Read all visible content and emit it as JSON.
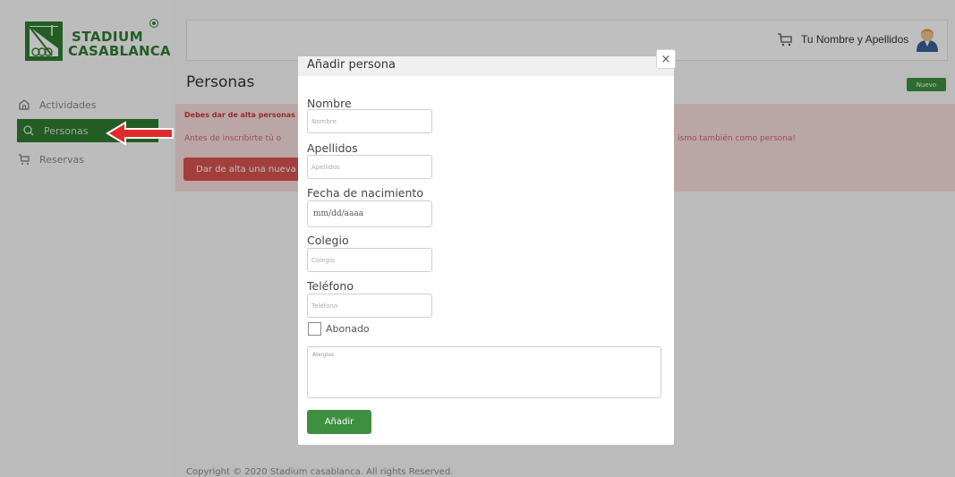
{
  "brand": {
    "line1": "STADIUM",
    "line2": "CASABLANCA",
    "accent": "#2f7d31"
  },
  "sidebar": {
    "items": [
      {
        "label": "Actividades",
        "icon": "home-icon"
      },
      {
        "label": "Personas",
        "icon": "search-icon",
        "active": true
      },
      {
        "label": "Reservas",
        "icon": "cart-icon"
      }
    ]
  },
  "header": {
    "user_name": "Tu Nombre y Apellidos"
  },
  "page": {
    "title": "Personas",
    "new_button": "Nuevo",
    "alert": {
      "title": "Debes dar de alta personas",
      "text_left": "Antes de inscribirte tú o",
      "text_right": "ismo también como persona!",
      "button": "Dar de alta una nueva"
    },
    "footer": "Copyright © 2020 Stadium casablanca. All rights Reserved."
  },
  "modal": {
    "title": "Añadir persona",
    "close": "×",
    "fields": {
      "nombre": {
        "label": "Nombre",
        "placeholder": "Nombre"
      },
      "apellidos": {
        "label": "Apellidos",
        "placeholder": "Apellidos"
      },
      "fecha": {
        "label": "Fecha de nacimiento",
        "value": "mm/dd/aaaa"
      },
      "colegio": {
        "label": "Colegio",
        "placeholder": "Colegio"
      },
      "telefono": {
        "label": "Teléfono",
        "placeholder": "Teléfono"
      },
      "abonado": {
        "label": "Abonado"
      },
      "alergias": {
        "placeholder": "Alergias"
      }
    },
    "submit": "Añadir"
  }
}
